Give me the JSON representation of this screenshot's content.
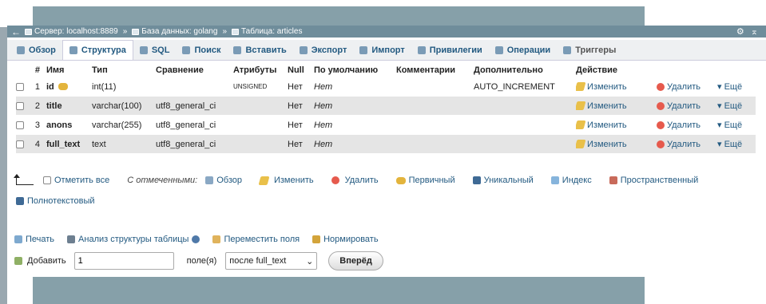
{
  "breadcrumb": {
    "back": "←",
    "server": "Сервер: localhost:8889",
    "database": "База данных: golang",
    "table": "Таблица: articles",
    "sep": "»",
    "settings_glyph": "⚙",
    "collapse_glyph": "⌅"
  },
  "tabs": [
    {
      "label": "Обзор",
      "icon": "browse-icon"
    },
    {
      "label": "Структура",
      "icon": "structure-icon"
    },
    {
      "label": "SQL",
      "icon": "sql-icon"
    },
    {
      "label": "Поиск",
      "icon": "search-icon"
    },
    {
      "label": "Вставить",
      "icon": "insert-icon"
    },
    {
      "label": "Экспорт",
      "icon": "export-icon"
    },
    {
      "label": "Импорт",
      "icon": "import-icon"
    },
    {
      "label": "Привилегии",
      "icon": "privileges-icon"
    },
    {
      "label": "Операции",
      "icon": "operations-icon"
    },
    {
      "label": "Триггеры",
      "icon": "triggers-icon"
    }
  ],
  "columns_header": {
    "num": "#",
    "name": "Имя",
    "type": "Тип",
    "collation": "Сравнение",
    "attributes": "Атрибуты",
    "null": "Null",
    "default": "По умолчанию",
    "comments": "Комментарии",
    "extra": "Дополнительно",
    "action": "Действие"
  },
  "rows": [
    {
      "num": "1",
      "name": "id",
      "type": "int(11)",
      "collation": "",
      "attributes": "UNSIGNED",
      "null": "Нет",
      "default": "Нет",
      "comments": "",
      "extra": "AUTO_INCREMENT"
    },
    {
      "num": "2",
      "name": "title",
      "type": "varchar(100)",
      "collation": "utf8_general_ci",
      "attributes": "",
      "null": "Нет",
      "default": "Нет",
      "comments": "",
      "extra": ""
    },
    {
      "num": "3",
      "name": "anons",
      "type": "varchar(255)",
      "collation": "utf8_general_ci",
      "attributes": "",
      "null": "Нет",
      "default": "Нет",
      "comments": "",
      "extra": ""
    },
    {
      "num": "4",
      "name": "full_text",
      "type": "text",
      "collation": "utf8_general_ci",
      "attributes": "",
      "null": "Нет",
      "default": "Нет",
      "comments": "",
      "extra": ""
    }
  ],
  "row_actions": {
    "edit": "Изменить",
    "delete": "Удалить",
    "more": "▾ Ещё"
  },
  "bulk": {
    "check_all": "Отметить все",
    "with_selected": "С отмеченными:",
    "browse": "Обзор",
    "edit": "Изменить",
    "delete": "Удалить",
    "primary": "Первичный",
    "unique": "Уникальный",
    "index": "Индекс",
    "spatial": "Пространственный",
    "fulltext": "Полнотекстовый"
  },
  "links": {
    "print": "Печать",
    "analyze": "Анализ структуры таблицы",
    "move": "Переместить поля",
    "normalize": "Нормировать"
  },
  "add": {
    "label": "Добавить",
    "count": "1",
    "fields": "поле(я)",
    "position": "после full_text",
    "go": "Вперёд"
  },
  "colors": {
    "link": "#235a81",
    "breadcrumb_bg": "#6f8d9b",
    "row_alt": "#e5e5e5"
  }
}
